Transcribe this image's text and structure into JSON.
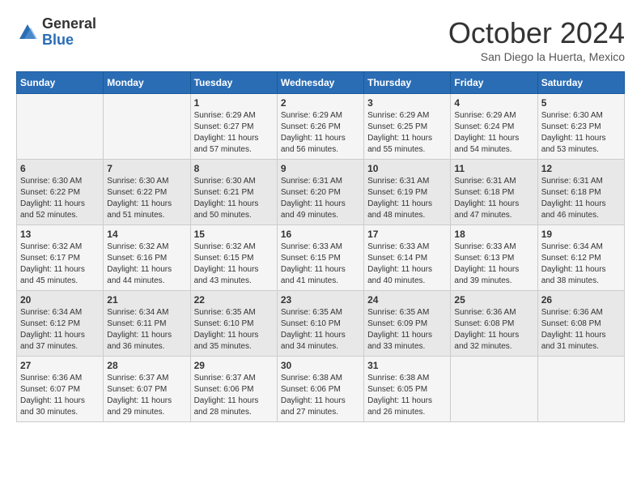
{
  "logo": {
    "general": "General",
    "blue": "Blue"
  },
  "title": "October 2024",
  "location": "San Diego la Huerta, Mexico",
  "days_of_week": [
    "Sunday",
    "Monday",
    "Tuesday",
    "Wednesday",
    "Thursday",
    "Friday",
    "Saturday"
  ],
  "weeks": [
    [
      {
        "day": "",
        "info": ""
      },
      {
        "day": "",
        "info": ""
      },
      {
        "day": "1",
        "info": "Sunrise: 6:29 AM\nSunset: 6:27 PM\nDaylight: 11 hours and 57 minutes."
      },
      {
        "day": "2",
        "info": "Sunrise: 6:29 AM\nSunset: 6:26 PM\nDaylight: 11 hours and 56 minutes."
      },
      {
        "day": "3",
        "info": "Sunrise: 6:29 AM\nSunset: 6:25 PM\nDaylight: 11 hours and 55 minutes."
      },
      {
        "day": "4",
        "info": "Sunrise: 6:29 AM\nSunset: 6:24 PM\nDaylight: 11 hours and 54 minutes."
      },
      {
        "day": "5",
        "info": "Sunrise: 6:30 AM\nSunset: 6:23 PM\nDaylight: 11 hours and 53 minutes."
      }
    ],
    [
      {
        "day": "6",
        "info": "Sunrise: 6:30 AM\nSunset: 6:22 PM\nDaylight: 11 hours and 52 minutes."
      },
      {
        "day": "7",
        "info": "Sunrise: 6:30 AM\nSunset: 6:22 PM\nDaylight: 11 hours and 51 minutes."
      },
      {
        "day": "8",
        "info": "Sunrise: 6:30 AM\nSunset: 6:21 PM\nDaylight: 11 hours and 50 minutes."
      },
      {
        "day": "9",
        "info": "Sunrise: 6:31 AM\nSunset: 6:20 PM\nDaylight: 11 hours and 49 minutes."
      },
      {
        "day": "10",
        "info": "Sunrise: 6:31 AM\nSunset: 6:19 PM\nDaylight: 11 hours and 48 minutes."
      },
      {
        "day": "11",
        "info": "Sunrise: 6:31 AM\nSunset: 6:18 PM\nDaylight: 11 hours and 47 minutes."
      },
      {
        "day": "12",
        "info": "Sunrise: 6:31 AM\nSunset: 6:18 PM\nDaylight: 11 hours and 46 minutes."
      }
    ],
    [
      {
        "day": "13",
        "info": "Sunrise: 6:32 AM\nSunset: 6:17 PM\nDaylight: 11 hours and 45 minutes."
      },
      {
        "day": "14",
        "info": "Sunrise: 6:32 AM\nSunset: 6:16 PM\nDaylight: 11 hours and 44 minutes."
      },
      {
        "day": "15",
        "info": "Sunrise: 6:32 AM\nSunset: 6:15 PM\nDaylight: 11 hours and 43 minutes."
      },
      {
        "day": "16",
        "info": "Sunrise: 6:33 AM\nSunset: 6:15 PM\nDaylight: 11 hours and 41 minutes."
      },
      {
        "day": "17",
        "info": "Sunrise: 6:33 AM\nSunset: 6:14 PM\nDaylight: 11 hours and 40 minutes."
      },
      {
        "day": "18",
        "info": "Sunrise: 6:33 AM\nSunset: 6:13 PM\nDaylight: 11 hours and 39 minutes."
      },
      {
        "day": "19",
        "info": "Sunrise: 6:34 AM\nSunset: 6:12 PM\nDaylight: 11 hours and 38 minutes."
      }
    ],
    [
      {
        "day": "20",
        "info": "Sunrise: 6:34 AM\nSunset: 6:12 PM\nDaylight: 11 hours and 37 minutes."
      },
      {
        "day": "21",
        "info": "Sunrise: 6:34 AM\nSunset: 6:11 PM\nDaylight: 11 hours and 36 minutes."
      },
      {
        "day": "22",
        "info": "Sunrise: 6:35 AM\nSunset: 6:10 PM\nDaylight: 11 hours and 35 minutes."
      },
      {
        "day": "23",
        "info": "Sunrise: 6:35 AM\nSunset: 6:10 PM\nDaylight: 11 hours and 34 minutes."
      },
      {
        "day": "24",
        "info": "Sunrise: 6:35 AM\nSunset: 6:09 PM\nDaylight: 11 hours and 33 minutes."
      },
      {
        "day": "25",
        "info": "Sunrise: 6:36 AM\nSunset: 6:08 PM\nDaylight: 11 hours and 32 minutes."
      },
      {
        "day": "26",
        "info": "Sunrise: 6:36 AM\nSunset: 6:08 PM\nDaylight: 11 hours and 31 minutes."
      }
    ],
    [
      {
        "day": "27",
        "info": "Sunrise: 6:36 AM\nSunset: 6:07 PM\nDaylight: 11 hours and 30 minutes."
      },
      {
        "day": "28",
        "info": "Sunrise: 6:37 AM\nSunset: 6:07 PM\nDaylight: 11 hours and 29 minutes."
      },
      {
        "day": "29",
        "info": "Sunrise: 6:37 AM\nSunset: 6:06 PM\nDaylight: 11 hours and 28 minutes."
      },
      {
        "day": "30",
        "info": "Sunrise: 6:38 AM\nSunset: 6:06 PM\nDaylight: 11 hours and 27 minutes."
      },
      {
        "day": "31",
        "info": "Sunrise: 6:38 AM\nSunset: 6:05 PM\nDaylight: 11 hours and 26 minutes."
      },
      {
        "day": "",
        "info": ""
      },
      {
        "day": "",
        "info": ""
      }
    ]
  ]
}
